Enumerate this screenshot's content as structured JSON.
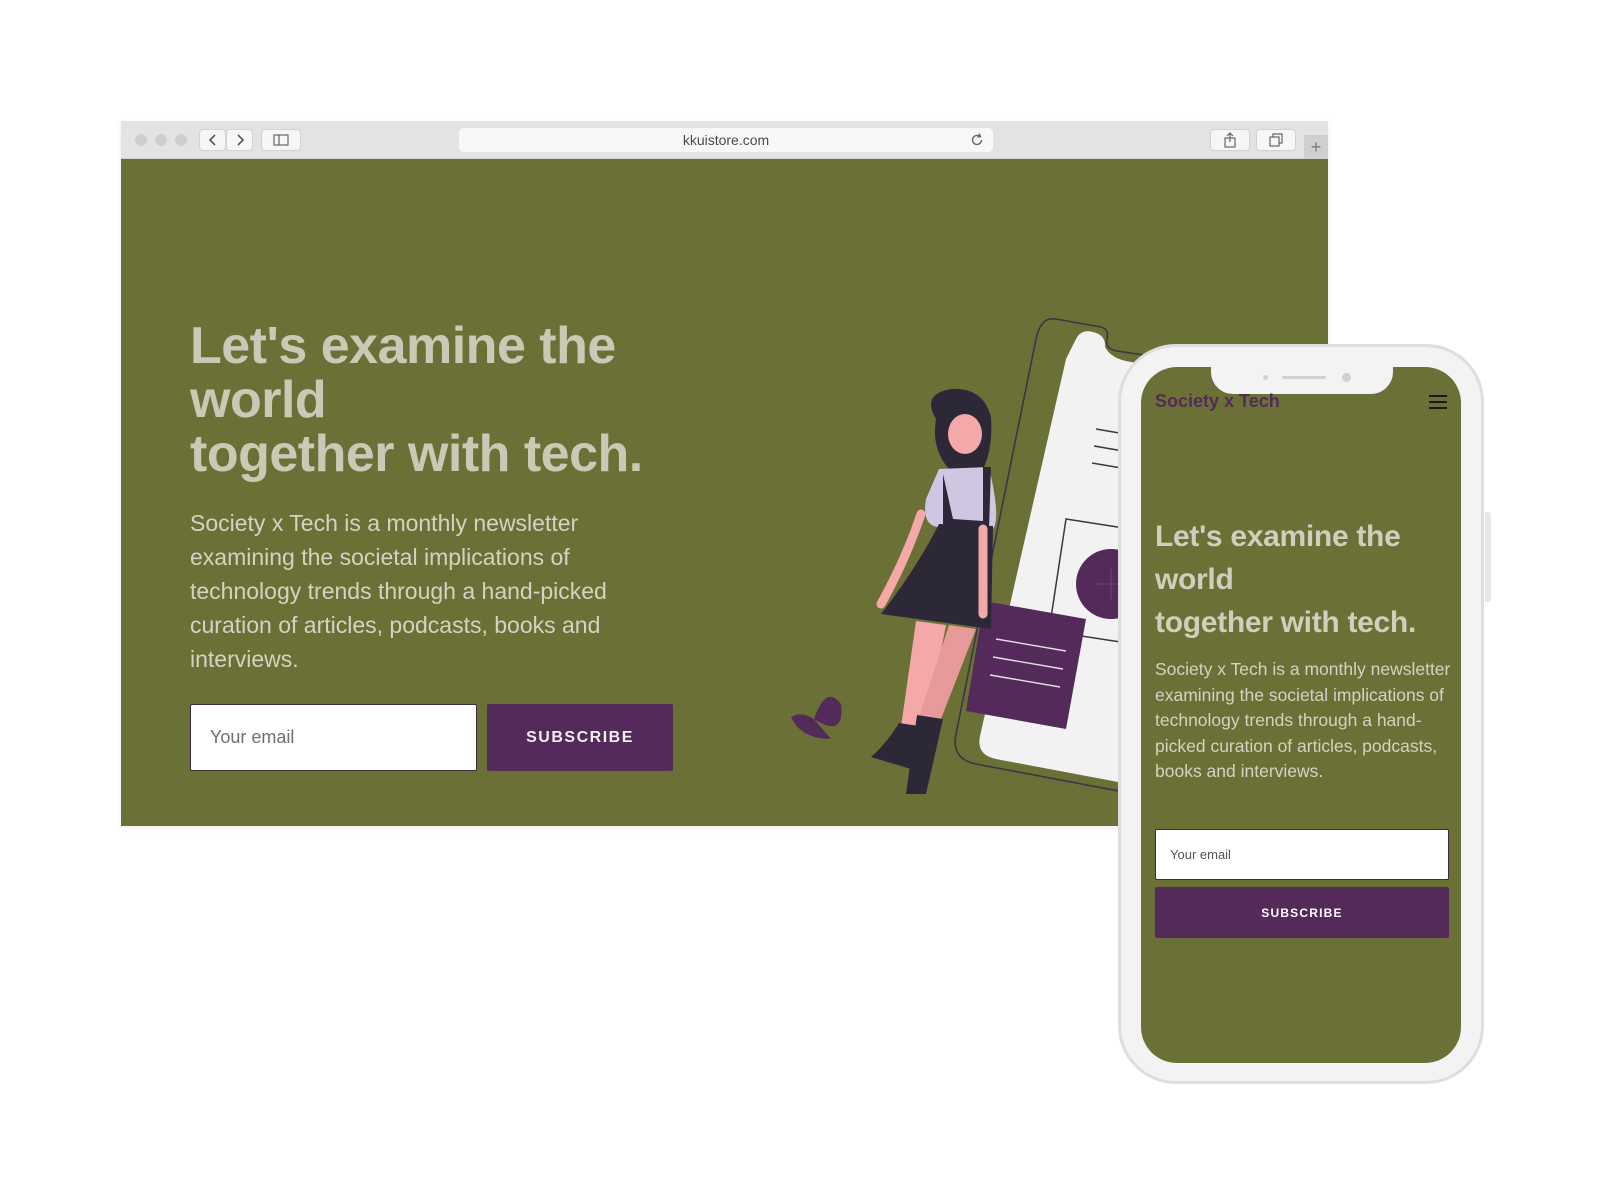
{
  "browser": {
    "url": "kkuistore.com",
    "new_tab_symbol": "+"
  },
  "hero": {
    "title_lines": [
      "Let's examine the",
      "world",
      "together with tech."
    ],
    "description": "Society x Tech is a monthly newsletter examining the societal implications of technology trends through a hand-picked curation of articles, podcasts, books and interviews.",
    "email_placeholder": "Your email",
    "subscribe_label": "SUBSCRIBE"
  },
  "mobile": {
    "brand": "Society x Tech",
    "title_lines": [
      "Let's examine the",
      "world",
      "together with tech."
    ],
    "description": "Society x Tech is a monthly newsletter examining the societal implications of technology trends through a hand-picked curation of articles, podcasts, books and interviews.",
    "email_placeholder": "Your email",
    "subscribe_label": "SUBSCRIBE"
  },
  "colors": {
    "background_olive": "#6b7136",
    "accent_purple": "#542a5a",
    "title_text": "#c9c9b6"
  },
  "icons": [
    "back-arrow-icon",
    "forward-arrow-icon",
    "sidebar-icon",
    "reload-icon",
    "share-icon",
    "tabs-icon",
    "plus-icon",
    "hamburger-menu-icon"
  ]
}
